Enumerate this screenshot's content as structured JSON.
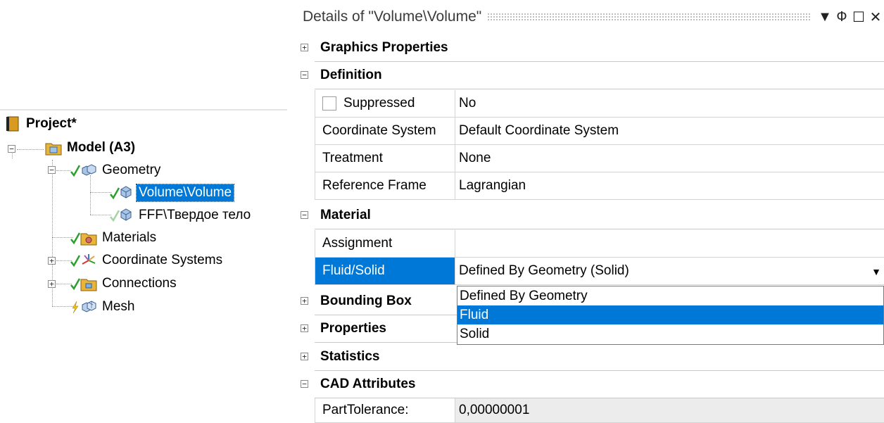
{
  "tree": {
    "project_label": "Project*",
    "model_label": "Model (A3)",
    "geometry_label": "Geometry",
    "volume_label": "Volume\\Volume",
    "fff_label": "FFF\\Твердое тело",
    "materials_label": "Materials",
    "coordinate_systems_label": "Coordinate Systems",
    "connections_label": "Connections",
    "mesh_label": "Mesh"
  },
  "details": {
    "title": "Details of \"Volume\\Volume\"",
    "title_buttons": [
      "▼",
      "Ф",
      "☐",
      "✕"
    ],
    "groups": {
      "graphics": "Graphics Properties",
      "definition": "Definition",
      "material": "Material",
      "bounding_box": "Bounding Box",
      "properties": "Properties",
      "statistics": "Statistics",
      "cad_attributes": "CAD Attributes"
    },
    "rows": {
      "suppressed": {
        "label": "Suppressed",
        "value": "No"
      },
      "coordinate_system": {
        "label": "Coordinate System",
        "value": "Default Coordinate System"
      },
      "treatment": {
        "label": "Treatment",
        "value": "None"
      },
      "reference_frame": {
        "label": "Reference Frame",
        "value": "Lagrangian"
      },
      "assignment": {
        "label": "Assignment",
        "value": ""
      },
      "fluid_solid": {
        "label": "Fluid/Solid",
        "value": "Defined By Geometry (Solid)"
      },
      "part_tolerance": {
        "label": "PartTolerance:",
        "value": "0,00000001"
      }
    },
    "dropdown_options": [
      "Defined By Geometry",
      "Fluid",
      "Solid"
    ],
    "dropdown_selected": "Fluid"
  },
  "colors": {
    "selection": "#0078d7",
    "check_green": "#2ca02c",
    "folder_yellow": "#e8b43a",
    "lightning": "#f2c200"
  }
}
